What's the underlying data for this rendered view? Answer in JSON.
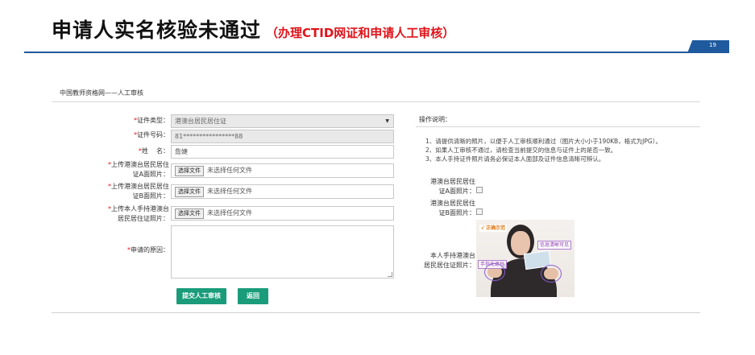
{
  "slide": {
    "title": "申请人实名核验未通过",
    "subtitle": "（办理CTID网证和申请人工审核）",
    "page_number": "19"
  },
  "breadcrumb": "中国教师资格网——人工审核",
  "form": {
    "id_type": {
      "label": "证件类型：",
      "value": "港澳台居民居住证"
    },
    "id_number": {
      "label": "证件号码：",
      "value": "81****************88"
    },
    "name": {
      "label_1": "姓",
      "label_2": "名：",
      "value": "詹婕"
    },
    "upload_front": {
      "label_line1": "上传港澳台居民居住",
      "label_line2": "证A面照片："
    },
    "upload_back": {
      "label_line1": "上传港澳台居民居住",
      "label_line2": "证B面照片："
    },
    "upload_handheld": {
      "label_line1": "上传本人手持港澳台",
      "label_line2": "居民居住证照片："
    },
    "file_button": "选择文件",
    "no_file": "未选择任何文件",
    "reason": {
      "label": "申请的原因：",
      "value": ""
    },
    "submit_label": "提交人工审核",
    "back_label": "返回"
  },
  "instructions": {
    "title": "操作说明：",
    "items": [
      "1、请提供清晰的照片，以便于人工审核顺利通过（图片大小小于190KB，格式为JPG）。",
      "2、如果人工审核不通过，请检查当前提交的信息与证件上的是否一致。",
      "3、本人手持证件照片请务必保证本人面部及证件信息清晰可辨认。"
    ],
    "front_label_line1": "港澳台居民居住",
    "front_label_line2": "证A面照片：",
    "back_label_line1": "港澳台居民居住",
    "back_label_line2": "证B面照片：",
    "handheld_label_line1": "本人手持港澳台",
    "handheld_label_line2": "居民居住证照片：",
    "sample_tag_ok": "√ 正确示范",
    "sample_tag_info": "信息清晰可见",
    "sample_tag_hand": "手指无遮挡"
  },
  "colors": {
    "accent_blue": "#1f5a9e",
    "button_green": "#1a9c7a",
    "required_red": "#e0131a"
  }
}
